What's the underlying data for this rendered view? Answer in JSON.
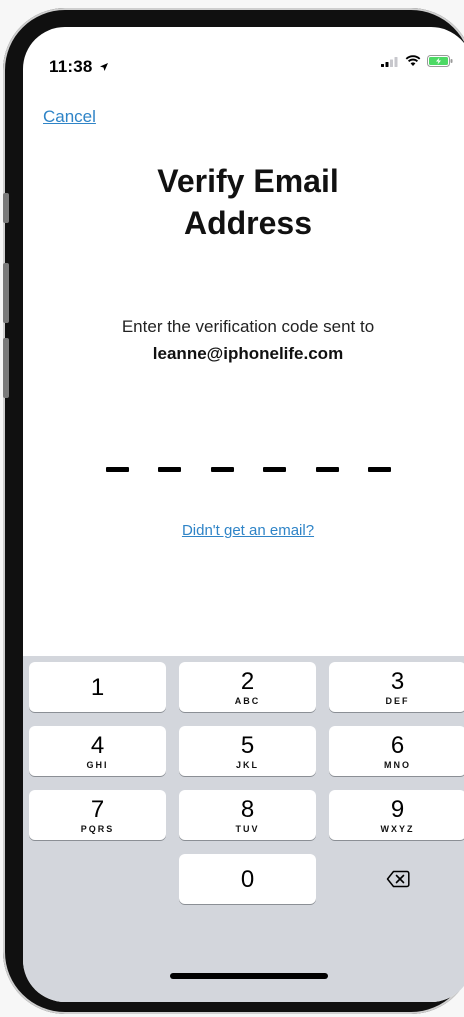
{
  "status_bar": {
    "time": "11:38"
  },
  "nav": {
    "cancel_label": "Cancel"
  },
  "title": {
    "line1": "Verify Email",
    "line2": "Address"
  },
  "instructions": {
    "text": "Enter the verification code sent to",
    "email": "leanne@iphonelife.com"
  },
  "code": {
    "length": 6,
    "entered": ""
  },
  "resend_link": "Didn't get an email?",
  "keypad": {
    "keys": [
      {
        "digit": "1",
        "letters": ""
      },
      {
        "digit": "2",
        "letters": "ABC"
      },
      {
        "digit": "3",
        "letters": "DEF"
      },
      {
        "digit": "4",
        "letters": "GHI"
      },
      {
        "digit": "5",
        "letters": "JKL"
      },
      {
        "digit": "6",
        "letters": "MNO"
      },
      {
        "digit": "7",
        "letters": "PQRS"
      },
      {
        "digit": "8",
        "letters": "TUV"
      },
      {
        "digit": "9",
        "letters": "WXYZ"
      },
      {
        "digit": "0",
        "letters": ""
      }
    ],
    "delete_icon": "backspace-icon"
  },
  "colors": {
    "link": "#2f84c7",
    "keyboard_bg": "#d3d6dc",
    "battery": "#4cd964"
  }
}
